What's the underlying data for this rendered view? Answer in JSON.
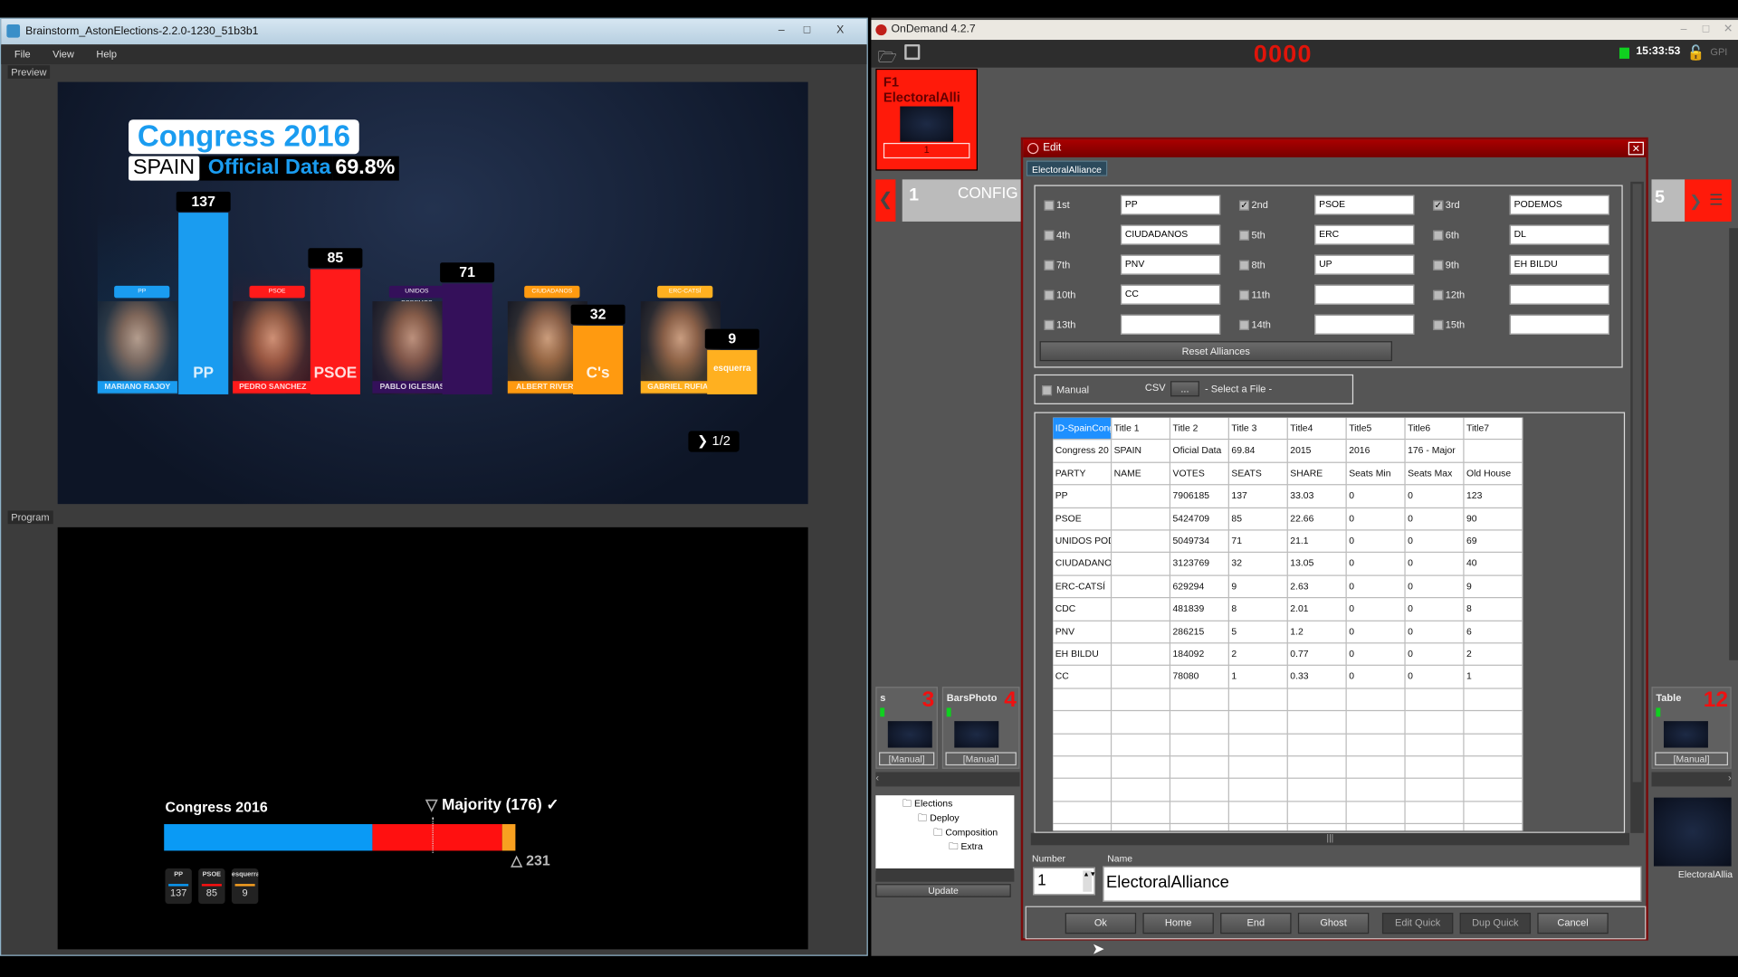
{
  "left_window": {
    "title": "Brainstorm_AstonElections-2.2.0-1230_51b3b1",
    "menu": [
      "File",
      "View",
      "Help"
    ],
    "preview_label": "Preview",
    "program_label": "Program",
    "controls": [
      "–",
      "□",
      "X"
    ]
  },
  "preview": {
    "title": "Congress 2016",
    "country": "SPAIN",
    "subtitle": "Official Data",
    "turnout": "69.8%",
    "page": "1/2",
    "parties": [
      {
        "tag": "PP",
        "leader": "MARIANO RAJOY",
        "seats": 137,
        "logo": "PP",
        "color": "#1a9cf0"
      },
      {
        "tag": "PSOE",
        "leader": "PEDRO SANCHEZ",
        "seats": 85,
        "logo": "PSOE",
        "color": "#ff1a1a"
      },
      {
        "tag": "UNIDOS PODEMOS",
        "leader": "PABLO IGLESIAS",
        "seats": 71,
        "logo": "",
        "color": "#34105a"
      },
      {
        "tag": "CIUDADANOS",
        "leader": "ALBERT RIVERA",
        "seats": 32,
        "logo": "C's",
        "color": "#ff9a10"
      },
      {
        "tag": "ERC-CATSÍ",
        "leader": "GABRIEL RUFIAN",
        "seats": 9,
        "logo": "esquerra",
        "color": "#ffb020"
      }
    ]
  },
  "program": {
    "title": "Congress 2016",
    "majority_label": "Majority (176)",
    "majority": 176,
    "total_label": "231",
    "total": 231,
    "segments": [
      {
        "logo": "PP",
        "seats": 137,
        "color": "#0a9af5"
      },
      {
        "logo": "PSOE",
        "seats": 85,
        "color": "#ff1010"
      },
      {
        "logo": "esquerra",
        "seats": 9,
        "color": "#f8a020"
      }
    ]
  },
  "ondemand": {
    "title": "OnDemand 4.2.7",
    "counter": "0000",
    "clock": "15:33:53",
    "gpi": "GPI",
    "f1_tile": {
      "key": "F1",
      "name": "ElectoralAlli",
      "number": "1"
    },
    "config_tile": {
      "number": "1",
      "label": "CONFIG"
    },
    "right_tile_number": "5",
    "bottom_tiles": [
      {
        "name": "s",
        "number": "3",
        "mode": "[Manual]"
      },
      {
        "name": "BarsPhoto",
        "number": "4",
        "mode": "[Manual]"
      },
      {
        "name": "Table",
        "number": "12",
        "mode": "[Manual]"
      }
    ],
    "tree": [
      "Elections",
      "Deploy",
      "Composition",
      "Extra"
    ],
    "update_label": "Update",
    "thumb_label": "ElectoralAllia"
  },
  "edit": {
    "title": "Edit",
    "tab": "ElectoralAlliance",
    "alliances": [
      {
        "label": "1st",
        "checked": false,
        "value": "PP"
      },
      {
        "label": "2nd",
        "checked": true,
        "value": "PSOE"
      },
      {
        "label": "3rd",
        "checked": true,
        "value": "PODEMOS"
      },
      {
        "label": "4th",
        "checked": false,
        "value": "CIUDADANOS"
      },
      {
        "label": "5th",
        "checked": false,
        "value": "ERC"
      },
      {
        "label": "6th",
        "checked": false,
        "value": "DL"
      },
      {
        "label": "7th",
        "checked": false,
        "value": "PNV"
      },
      {
        "label": "8th",
        "checked": false,
        "value": "UP"
      },
      {
        "label": "9th",
        "checked": false,
        "value": "EH BILDU"
      },
      {
        "label": "10th",
        "checked": false,
        "value": "CC"
      },
      {
        "label": "11th",
        "checked": false,
        "value": ""
      },
      {
        "label": "12th",
        "checked": false,
        "value": ""
      },
      {
        "label": "13th",
        "checked": false,
        "value": ""
      },
      {
        "label": "14th",
        "checked": false,
        "value": ""
      },
      {
        "label": "15th",
        "checked": false,
        "value": ""
      }
    ],
    "reset_label": "Reset Alliances",
    "manual_label": "Manual",
    "csv_label": "CSV",
    "csv_button": "...",
    "csv_file": "- Select a File -",
    "grid": [
      [
        "ID-SpainCong",
        "Title 1",
        "Title 2",
        "Title 3",
        "Title4",
        "Title5",
        "Title6",
        "Title7"
      ],
      [
        "Congress 20",
        "SPAIN",
        "Oficial Data",
        "69.84",
        "2015",
        "2016",
        "176 - Major",
        ""
      ],
      [
        "PARTY",
        "NAME",
        "VOTES",
        "SEATS",
        "SHARE",
        "Seats Min",
        "Seats Max",
        "Old House"
      ],
      [
        "PP",
        "",
        "7906185",
        "137",
        "33.03",
        "0",
        "0",
        "123"
      ],
      [
        "PSOE",
        "",
        "5424709",
        "85",
        "22.66",
        "0",
        "0",
        "90"
      ],
      [
        "UNIDOS POD",
        "",
        "5049734",
        "71",
        "21.1",
        "0",
        "0",
        "69"
      ],
      [
        "CIUDADANOS",
        "",
        "3123769",
        "32",
        "13.05",
        "0",
        "0",
        "40"
      ],
      [
        "ERC-CATSÍ",
        "",
        "629294",
        "9",
        "2.63",
        "0",
        "0",
        "9"
      ],
      [
        "CDC",
        "",
        "481839",
        "8",
        "2.01",
        "0",
        "0",
        "8"
      ],
      [
        "PNV",
        "",
        "286215",
        "5",
        "1.2",
        "0",
        "0",
        "6"
      ],
      [
        "EH BILDU",
        "",
        "184092",
        "2",
        "0.77",
        "0",
        "0",
        "2"
      ],
      [
        "CC",
        "",
        "78080",
        "1",
        "0.33",
        "0",
        "0",
        "1"
      ]
    ],
    "number_label": "Number",
    "number_value": "1",
    "name_label": "Name",
    "name_value": "ElectoralAlliance",
    "buttons": [
      "Ok",
      "Home",
      "End",
      "Ghost",
      "Edit Quick",
      "Dup Quick",
      "Cancel"
    ]
  }
}
